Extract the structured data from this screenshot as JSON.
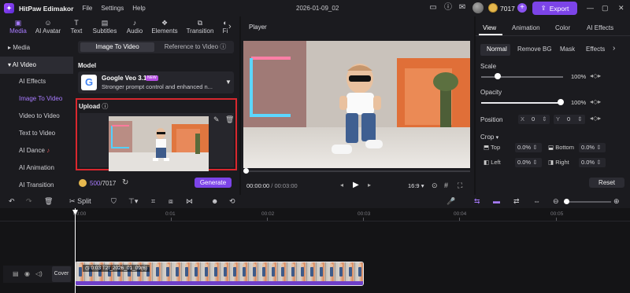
{
  "app": {
    "name": "HitPaw Edimakor",
    "menu": [
      "File",
      "Settings",
      "Help"
    ],
    "project": "2026-01-09_02",
    "credits": "7017",
    "export_label": "Export"
  },
  "left_tabs": [
    {
      "icon": "media-icon",
      "label": "Media"
    },
    {
      "icon": "ai-avatar-icon",
      "label": "AI Avatar"
    },
    {
      "icon": "text-icon",
      "label": "Text"
    },
    {
      "icon": "subtitles-icon",
      "label": "Subtitles"
    },
    {
      "icon": "audio-icon",
      "label": "Audio"
    },
    {
      "icon": "elements-icon",
      "label": "Elements"
    },
    {
      "icon": "transition-icon",
      "label": "Transition"
    },
    {
      "icon": "filter-icon",
      "label": "Fi"
    }
  ],
  "sidebar": {
    "media": "Media",
    "ai_video": "AI Video",
    "items": [
      "AI Effects",
      "Image To Video",
      "Video to Video",
      "Text to Video",
      "AI Dance",
      "AI Animation",
      "AI Transition"
    ],
    "active_item": "Image To Video"
  },
  "generator": {
    "tab_active": "Image To Video",
    "tab_other": "Reference to Video",
    "model_heading": "Model",
    "model_name": "Google Veo 3.1",
    "model_badge": "NEW",
    "model_desc": "Stronger prompt control and enhanced n...",
    "upload_heading": "Upload",
    "credit_usage": "500",
    "credit_total": "/7017",
    "generate_label": "Generate"
  },
  "player": {
    "title": "Player",
    "time_current": "00:00:00",
    "time_total": "/ 00:03:00",
    "aspect": "16:9"
  },
  "inspector": {
    "tabs": [
      "View",
      "Animation",
      "Color",
      "AI Effects"
    ],
    "active_tab": "View",
    "subtabs": [
      "Normal",
      "Remove BG",
      "Mask",
      "Effects"
    ],
    "scale_label": "Scale",
    "scale_value": "100%",
    "scale_level": 1.0,
    "opacity_label": "Opacity",
    "opacity_value": "100%",
    "opacity_level": 1.0,
    "position_label": "Position",
    "pos_x_label": "X",
    "pos_x": "0",
    "pos_y_label": "Y",
    "pos_y": "0",
    "crop_label": "Crop",
    "crop_top_label": "Top",
    "crop_top": "0.0%",
    "crop_bottom_label": "Bottom",
    "crop_bottom": "0.0%",
    "crop_left_label": "Left",
    "crop_left": "0.0%",
    "crop_right_label": "Right",
    "crop_right": "0.0%",
    "reset_label": "Reset"
  },
  "toolbar": {
    "split_label": "Split"
  },
  "timeline": {
    "ruler": [
      "00:00",
      "0:01",
      "00:02",
      "00:03",
      "00:04",
      "00:05"
    ],
    "clip_label": "0:03 T2I_2026_01_09(6)",
    "cover_label": "Cover"
  }
}
